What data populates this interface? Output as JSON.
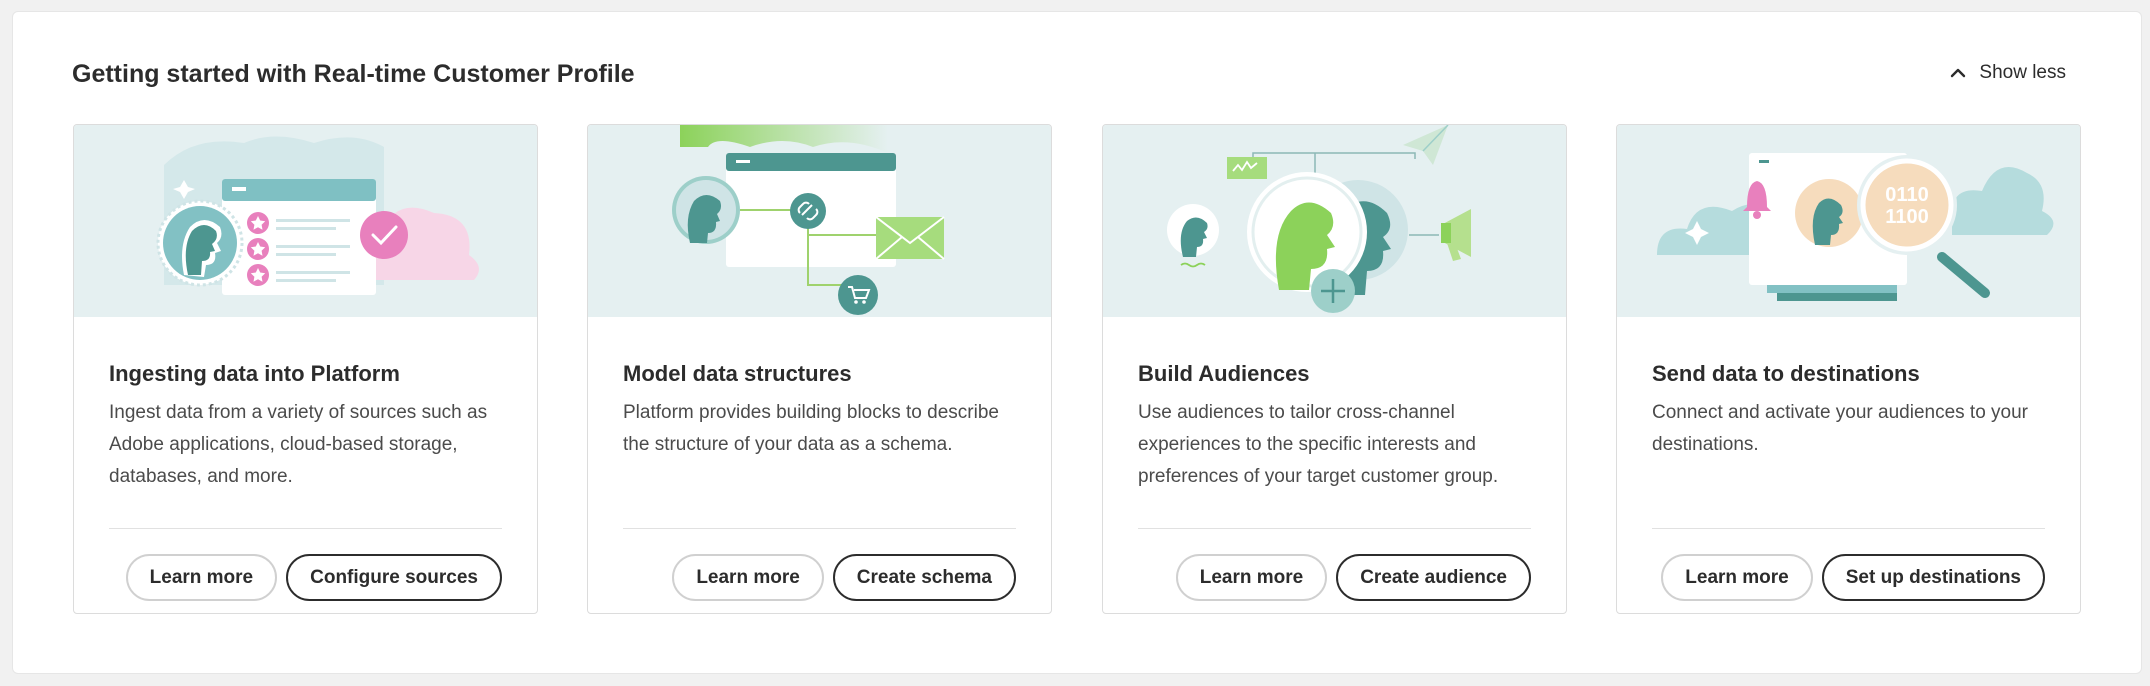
{
  "header": {
    "title": "Getting started with Real-time Customer Profile",
    "toggle_label": "Show less"
  },
  "cards": [
    {
      "title": "Ingesting data into Platform",
      "description": "Ingest data from a variety of sources such as Adobe applications, cloud-based storage, databases, and more.",
      "secondary_label": "Learn more",
      "primary_label": "Configure sources"
    },
    {
      "title": "Model data structures",
      "description": "Platform provides building blocks to describe the structure of your data as a schema.",
      "secondary_label": "Learn more",
      "primary_label": "Create schema"
    },
    {
      "title": "Build Audiences",
      "description": "Use audiences to tailor cross-channel experiences to the specific interests and preferences of your target customer group.",
      "secondary_label": "Learn more",
      "primary_label": "Create audience"
    },
    {
      "title": "Send data to destinations",
      "description": "Connect and activate your audiences to your destinations.",
      "secondary_label": "Learn more",
      "primary_label": "Set up destinations"
    }
  ],
  "colors": {
    "illustration_bg": "#e5f0f1",
    "teal": "#4d9690",
    "light_teal": "#82c1c4",
    "green": "#8cd25a",
    "pink": "#e880bd",
    "peach": "#f6dcbd"
  },
  "icons": [
    "chevron-up-icon",
    "ingest-illustration",
    "schema-illustration",
    "audience-illustration",
    "destination-illustration"
  ]
}
